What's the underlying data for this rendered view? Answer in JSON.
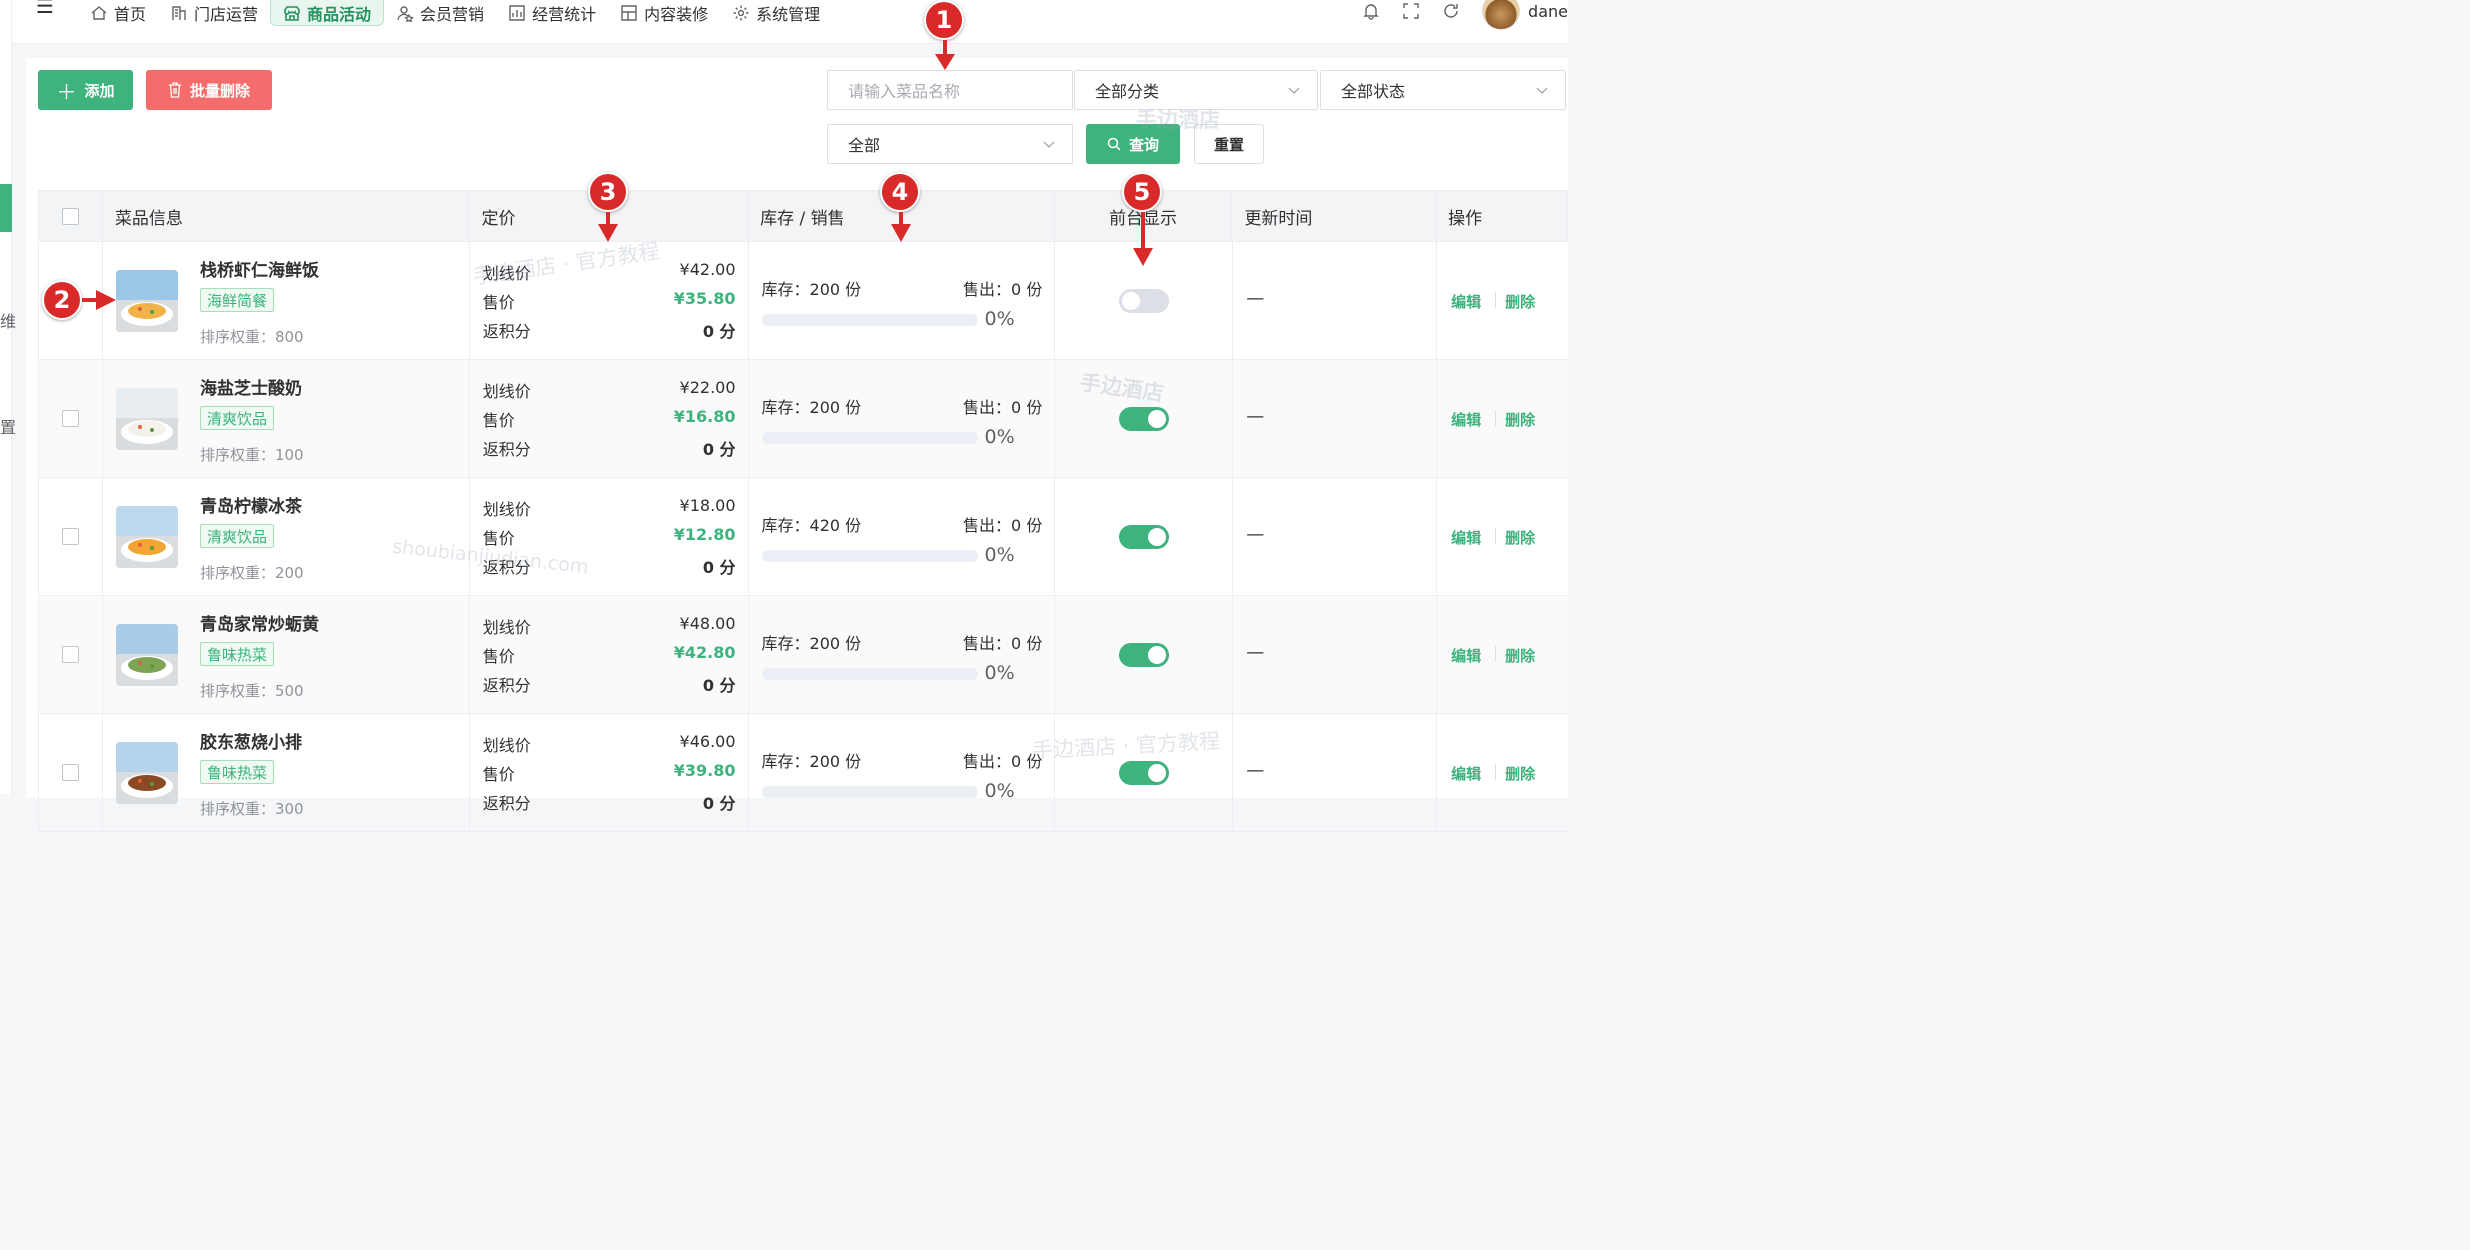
{
  "sidebar": {
    "fragment_1": "维",
    "fragment_2": "置"
  },
  "topbar": {
    "nav": [
      {
        "label": "首页",
        "icon": "home-icon"
      },
      {
        "label": "门店运营",
        "icon": "store-icon"
      },
      {
        "label": "商品活动",
        "icon": "shop-icon"
      },
      {
        "label": "会员营销",
        "icon": "member-icon"
      },
      {
        "label": "经营统计",
        "icon": "chart-icon"
      },
      {
        "label": "内容装修",
        "icon": "layout-icon"
      },
      {
        "label": "系统管理",
        "icon": "gear-icon"
      }
    ],
    "active_index": 2,
    "user_name": "dane"
  },
  "toolbar": {
    "add_label": "添加",
    "batch_delete_label": "批量删除"
  },
  "filters": {
    "name_placeholder": "请输入菜品名称",
    "category": "全部分类",
    "status": "全部状态",
    "scope": "全部",
    "query_label": "查询",
    "reset_label": "重置"
  },
  "table": {
    "headers": {
      "info": "菜品信息",
      "price": "定价",
      "stock": "库存 / 销售",
      "display": "前台显示",
      "updated": "更新时间",
      "action": "操作"
    },
    "labels": {
      "list_price": "划线价",
      "sale_price": "售价",
      "points": "返积分",
      "edit": "编辑",
      "delete": "删除"
    },
    "rows": [
      {
        "name": "栈桥虾仁海鲜饭",
        "tag": "海鲜简餐",
        "weight": "排序权重：800",
        "list_price": "¥42.00",
        "sale_price": "¥35.80",
        "points": "0 分",
        "stock": "库存：200 份",
        "sold": "售出：0 份",
        "percent": 0,
        "percent_text": "0%",
        "display_on": false,
        "updated": "—"
      },
      {
        "name": "海盐芝士酸奶",
        "tag": "清爽饮品",
        "weight": "排序权重：100",
        "list_price": "¥22.00",
        "sale_price": "¥16.80",
        "points": "0 分",
        "stock": "库存：200 份",
        "sold": "售出：0 份",
        "percent": 0,
        "percent_text": "0%",
        "display_on": true,
        "updated": "—"
      },
      {
        "name": "青岛柠檬冰茶",
        "tag": "清爽饮品",
        "weight": "排序权重：200",
        "list_price": "¥18.00",
        "sale_price": "¥12.80",
        "points": "0 分",
        "stock": "库存：420 份",
        "sold": "售出：0 份",
        "percent": 0,
        "percent_text": "0%",
        "display_on": true,
        "updated": "—"
      },
      {
        "name": "青岛家常炒蛎黄",
        "tag": "鲁味热菜",
        "weight": "排序权重：500",
        "list_price": "¥48.00",
        "sale_price": "¥42.80",
        "points": "0 分",
        "stock": "库存：200 份",
        "sold": "售出：0 份",
        "percent": 0,
        "percent_text": "0%",
        "display_on": true,
        "updated": "—"
      },
      {
        "name": "胶东葱烧小排",
        "tag": "鲁味热菜",
        "weight": "排序权重：300",
        "list_price": "¥46.00",
        "sale_price": "¥39.80",
        "points": "0 分",
        "stock": "库存：200 份",
        "sold": "售出：0 份",
        "percent": 0,
        "percent_text": "0%",
        "display_on": true,
        "updated": "—"
      }
    ]
  },
  "watermarks": {
    "brand_a": "手边酒店",
    "brand_b": "手边酒店",
    "tutorial_a": "手边酒店 · 官方教程",
    "tutorial_b": "手边酒店 · 官方教程",
    "domain": "shoubianjiudian.com"
  },
  "annotations": [
    "1",
    "2",
    "3",
    "4",
    "5"
  ],
  "colors": {
    "accent": "#3eb37e",
    "danger": "#f56c6c",
    "annotation": "#d92a2a"
  }
}
